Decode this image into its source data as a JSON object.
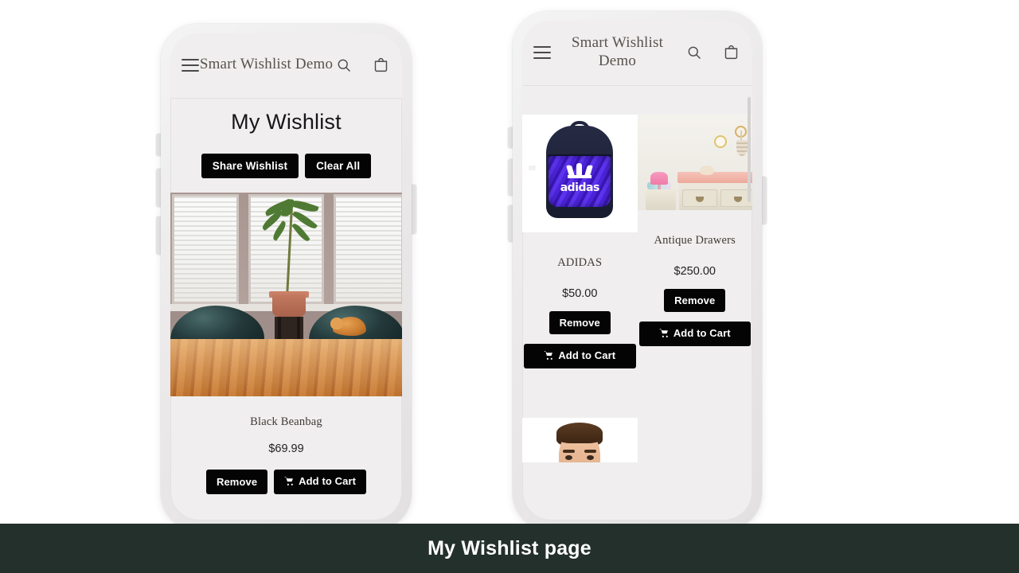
{
  "caption": {
    "text": "My Wishlist page"
  },
  "theme": {
    "page_bg": "#ffffff",
    "caption_bar_bg": "#24302b",
    "screen_bg": "#f0eeee",
    "button_bg": "#040404",
    "button_text": "#ffffff"
  },
  "header": {
    "shop_title": "Smart Wishlist Demo",
    "menu_icon": "hamburger-menu-icon",
    "search_icon": "search-icon",
    "cart_icon": "shopping-bag-icon"
  },
  "phone_left": {
    "page_title": "My Wishlist",
    "actions": [
      {
        "label": "Share Wishlist",
        "name": "share-wishlist-button"
      },
      {
        "label": "Clear All",
        "name": "clear-all-button"
      }
    ],
    "product": {
      "name": "Black Beanbag",
      "price": "$69.99",
      "image_alt": "Black beanbag chairs in a sunlit room with a plant and a cat",
      "remove_label": "Remove",
      "add_to_cart_label": "Add to Cart",
      "cart_icon": "shopping-cart-icon"
    }
  },
  "phone_right": {
    "products": [
      {
        "name": "ADIDAS",
        "price": "$50.00",
        "image_alt": "Navy and blue adidas backpack",
        "remove_label": "Remove",
        "add_to_cart_label": "Add to Cart",
        "cart_icon": "shopping-cart-icon"
      },
      {
        "name": "Antique Drawers",
        "price": "$250.00",
        "image_alt": "Nursery with antique changing table and pink lamp",
        "remove_label": "Remove",
        "add_to_cart_label": "Add to Cart",
        "cart_icon": "shopping-cart-icon"
      }
    ],
    "partial_product": {
      "image_alt": "Portrait of a man, partially visible"
    }
  }
}
